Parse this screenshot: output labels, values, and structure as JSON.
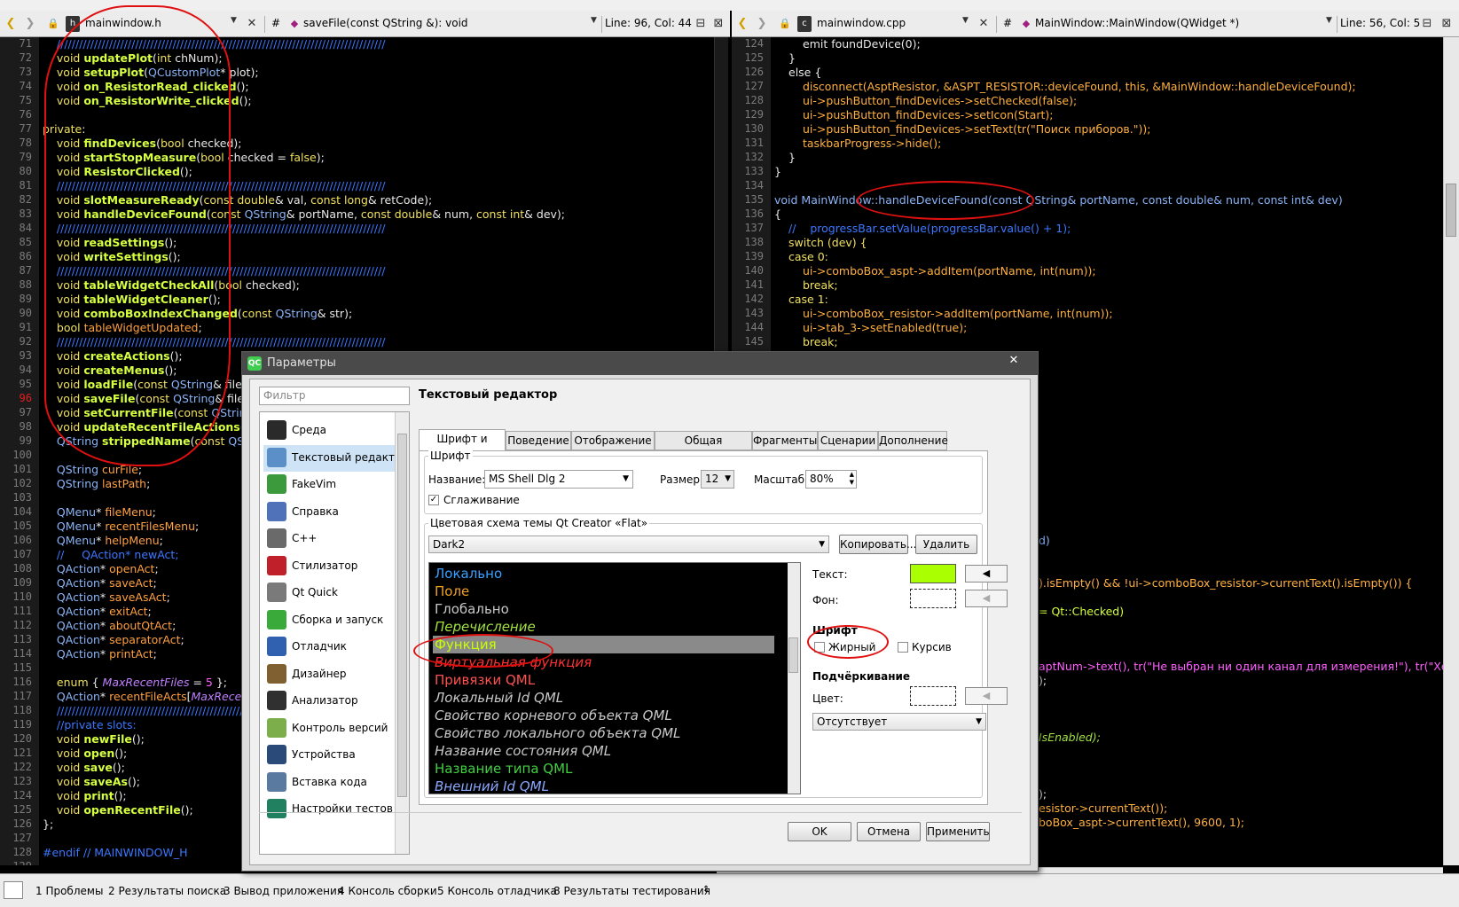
{
  "left_editor": {
    "file": "mainwindow.h",
    "symbol": "saveFile(const QString &): void",
    "position": "Line: 96, Col: 44",
    "hash_label": "#"
  },
  "right_editor": {
    "file": "mainwindow.cpp",
    "symbol": "MainWindow::MainWindow(QWidget *)",
    "position": "Line: 56, Col: 5",
    "hash_label": "#"
  },
  "left_lines": [
    "71",
    "72",
    "73",
    "74",
    "75",
    "76",
    "77",
    "78",
    "79",
    "80",
    "81",
    "82",
    "83",
    "84",
    "85",
    "86",
    "87",
    "88",
    "89",
    "90",
    "91",
    "92",
    "93",
    "94",
    "95",
    "96",
    "97",
    "98",
    "99",
    "100",
    "101",
    "102",
    "103",
    "104",
    "105",
    "106",
    "107",
    "108",
    "109",
    "110",
    "111",
    "112",
    "113",
    "114",
    "115",
    "116",
    "117",
    "118",
    "119",
    "120",
    "121",
    "122",
    "123",
    "124",
    "125",
    "126",
    "127",
    "128",
    "129"
  ],
  "right_lines": [
    "124",
    "125",
    "126",
    "127",
    "128",
    "129",
    "130",
    "131",
    "132",
    "133",
    "134",
    "135",
    "136",
    "137",
    "138",
    "139",
    "140",
    "141",
    "142",
    "143",
    "144",
    "145"
  ],
  "right_code": {
    "l124": "emit foundDevice(0);",
    "l125": "}",
    "l126": "else {",
    "l127": "disconnect(AsptResistor, &ASPT_RESISTOR::deviceFound, this, &MainWindow::handleDeviceFound);",
    "l128": "ui->pushButton_findDevices->setChecked(false);",
    "l129": "ui->pushButton_findDevices->setIcon(Start);",
    "l130": "ui->pushButton_findDevices->setText(tr(\"Поиск приборов.\"));",
    "l131": "taskbarProgress->hide();",
    "l132": "}",
    "l133": "}",
    "l135": "void MainWindow::handleDeviceFound(const QString& portName, const double& num, const int& dev)",
    "l136": "{",
    "l137": "//    progressBar.setValue(progressBar.value() + 1);",
    "l138": "switch (dev) {",
    "l139": "case 0:",
    "l140": "ui->comboBox_aspt->addItem(portName, int(num));",
    "l141": "break;",
    "l142": "case 1:",
    "l143": "ui->comboBox_resistor->addItem(portName, int(num));",
    "l144": "ui->tab_3->setEnabled(true);",
    "l145": "break;"
  },
  "right_fragments": {
    "f1": "d)",
    "f2": ").isEmpty() && !ui->comboBox_resistor->currentText().isEmpty()) {",
    "f3": "= Qt::Checked)",
    "f4": "aptNum->text(), tr(\"Не выбран ни один канал для измерения!\"), tr(\"Хорошо\"));",
    "f5": ");",
    "f6": "IsEnabled);",
    "f7": ");",
    "f8": "esistor->currentText());",
    "f9": "boBox_aspt->currentText(), 9600, 1);"
  },
  "output_panes": [
    "1  Проблемы",
    "2  Результаты поиска",
    "3  Вывод приложения",
    "4  Консоль сборки",
    "5  Консоль отладчика",
    "8  Результаты тестирования"
  ],
  "dialog": {
    "title": "Параметры",
    "close": "✕",
    "filter_placeholder": "Фильтр",
    "heading": "Текстовый редактор",
    "nav": [
      {
        "label": "Среда",
        "icon": "monitor-icon",
        "color": "#2a2a2a"
      },
      {
        "label": "Текстовый редактор",
        "icon": "text-editor-icon",
        "color": "#5b8fc7"
      },
      {
        "label": "FakeVim",
        "icon": "fakevim-icon",
        "color": "#3c9a3c"
      },
      {
        "label": "Справка",
        "icon": "help-icon",
        "color": "#4f72b8"
      },
      {
        "label": "C++",
        "icon": "cpp-icon",
        "color": "#6a6a6a"
      },
      {
        "label": "Стилизатор",
        "icon": "high-heel-icon",
        "color": "#c0202a"
      },
      {
        "label": "Qt Quick",
        "icon": "qt-quick-icon",
        "color": "#7a7a7a"
      },
      {
        "label": "Сборка и запуск",
        "icon": "build-run-icon",
        "color": "#3aaa3a"
      },
      {
        "label": "Отладчик",
        "icon": "debugger-icon",
        "color": "#3060b0"
      },
      {
        "label": "Дизайнер",
        "icon": "designer-icon",
        "color": "#806030"
      },
      {
        "label": "Анализатор",
        "icon": "analyzer-icon",
        "color": "#303030"
      },
      {
        "label": "Контроль версий",
        "icon": "version-control-icon",
        "color": "#7cae4c"
      },
      {
        "label": "Устройства",
        "icon": "devices-icon",
        "color": "#2a4a7a"
      },
      {
        "label": "Вставка кода",
        "icon": "code-paste-icon",
        "color": "#5a7aa0"
      },
      {
        "label": "Настройки тестов",
        "icon": "tests-icon",
        "color": "#208060"
      }
    ],
    "tabs": [
      "Шрифт и цвета",
      "Поведение",
      "Отображение",
      "Общая подсветка",
      "Фрагменты",
      "Сценарии",
      "Дополнение"
    ],
    "font_group": "Шрифт",
    "name_label": "Название:",
    "name_value": "MS Shell Dlg 2",
    "size_label": "Размер:",
    "size_value": "12",
    "scale_label": "Масштаб:",
    "scale_value": "80%",
    "antialias_label": "Сглаживание",
    "scheme_group": "Цветовая схема темы Qt Creator «Flat»",
    "scheme_value": "Dark2",
    "copy_btn": "Копировать...",
    "delete_btn": "Удалить",
    "categories": [
      {
        "label": "Локально",
        "color": "#3aa0ff",
        "italic": false
      },
      {
        "label": "Поле",
        "color": "#f0a020",
        "italic": false
      },
      {
        "label": "Глобально",
        "color": "#c8c8c8",
        "italic": false
      },
      {
        "label": "Перечисление",
        "color": "#a0e040",
        "italic": true
      },
      {
        "label": "Функция",
        "color": "#c8ff00",
        "italic": false
      },
      {
        "label": "Виртуальная функция",
        "color": "#ff3030",
        "italic": true
      },
      {
        "label": "Привязки QML",
        "color": "#ff5050",
        "italic": false
      },
      {
        "label": "Локальный Id QML",
        "color": "#c8c8c8",
        "italic": true
      },
      {
        "label": "Свойство корневого объекта QML",
        "color": "#c8c8c8",
        "italic": true
      },
      {
        "label": "Свойство локального объекта QML",
        "color": "#c8c8c8",
        "italic": true
      },
      {
        "label": "Название состояния QML",
        "color": "#c8c8c8",
        "italic": true
      },
      {
        "label": "Название типа QML",
        "color": "#40d040",
        "italic": false
      },
      {
        "label": "Внешний Id QML",
        "color": "#8aa8ff",
        "italic": true
      }
    ],
    "text_label": "Текст:",
    "text_color": "#aaff00",
    "bg_label": "Фон:",
    "font_sub": "Шрифт",
    "bold_label": "Жирный",
    "italic_label": "Курсив",
    "underline_label": "Подчёркивание",
    "color_label": "Цвет:",
    "underline_value": "Отсутствует",
    "ok": "OK",
    "cancel": "Отмена",
    "apply": "Применить"
  },
  "colors": {
    "annotation": "#e01010",
    "selection_row": "#8a8a8a",
    "editor_bg": "#000000"
  }
}
